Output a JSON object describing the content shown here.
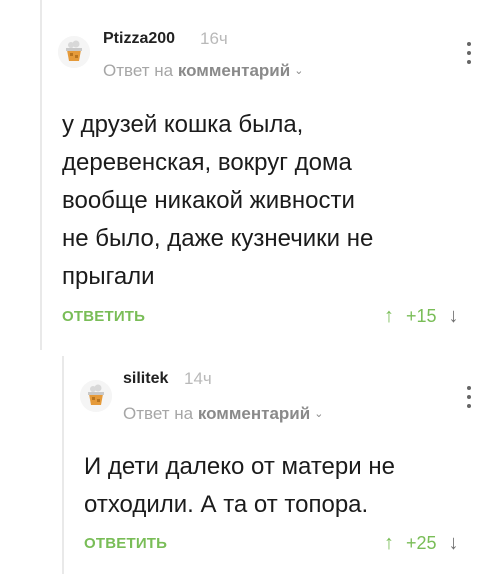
{
  "comments": [
    {
      "username": "Ptizza200",
      "time": "16ч",
      "reply_prefix": "Ответ на",
      "reply_target": "комментарий",
      "text_lines": [
        "у друзей кошка была,",
        "деревенская, вокруг дома",
        "вообще никакой живности",
        "не было, даже кузнечики не",
        "прыгали"
      ],
      "reply_button": "ОТВЕТИТЬ",
      "score": "+15",
      "up_icon": "↑",
      "down_icon": "↓",
      "chevron": "⌄"
    },
    {
      "username": "silitek",
      "time": "14ч",
      "reply_prefix": "Ответ на",
      "reply_target": "комментарий",
      "text_lines": [
        "И дети далеко от матери не",
        "отходили. А та от топора."
      ],
      "reply_button": "ОТВЕТИТЬ",
      "score": "+25",
      "up_icon": "↑",
      "down_icon": "↓",
      "chevron": "⌄"
    }
  ],
  "colors": {
    "accent_green": "#79bd57",
    "muted_gray": "#b9b9b9",
    "thread_line": "#e9e9e9"
  },
  "icons": [
    "avatar-icon",
    "more-options-icon",
    "chevron-down-icon",
    "upvote-arrow-icon",
    "downvote-arrow-icon"
  ]
}
